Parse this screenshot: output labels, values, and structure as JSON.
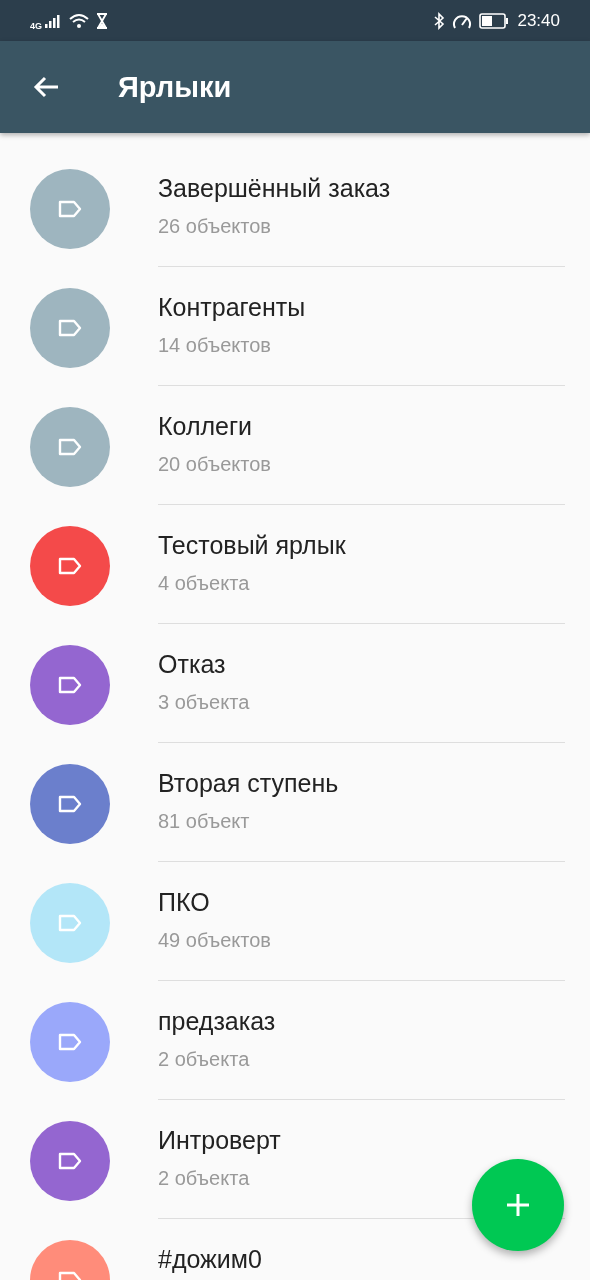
{
  "status_bar": {
    "network": "4G",
    "time": "23:40"
  },
  "app_bar": {
    "title": "Ярлыки"
  },
  "labels": [
    {
      "name": "Завершённый заказ",
      "count": "26 объектов",
      "color": "#9eb5bf"
    },
    {
      "name": "Контрагенты",
      "count": "14 объектов",
      "color": "#9eb5bf"
    },
    {
      "name": "Коллеги",
      "count": "20 объектов",
      "color": "#9eb5bf"
    },
    {
      "name": "Тестовый ярлык",
      "count": "4 объекта",
      "color": "#f44a4a"
    },
    {
      "name": "Отказ",
      "count": "3 объекта",
      "color": "#9466d0"
    },
    {
      "name": "Вторая ступень",
      "count": "81 объект",
      "color": "#6b7fcc"
    },
    {
      "name": "ПКО",
      "count": "49 объектов",
      "color": "#b3e6f8"
    },
    {
      "name": "предзаказ",
      "count": "2 объекта",
      "color": "#9aa8fa"
    },
    {
      "name": "Интроверт",
      "count": "2 объекта",
      "color": "#9466d0"
    },
    {
      "name": "#дожим0",
      "color": "#ff8c7a"
    }
  ]
}
